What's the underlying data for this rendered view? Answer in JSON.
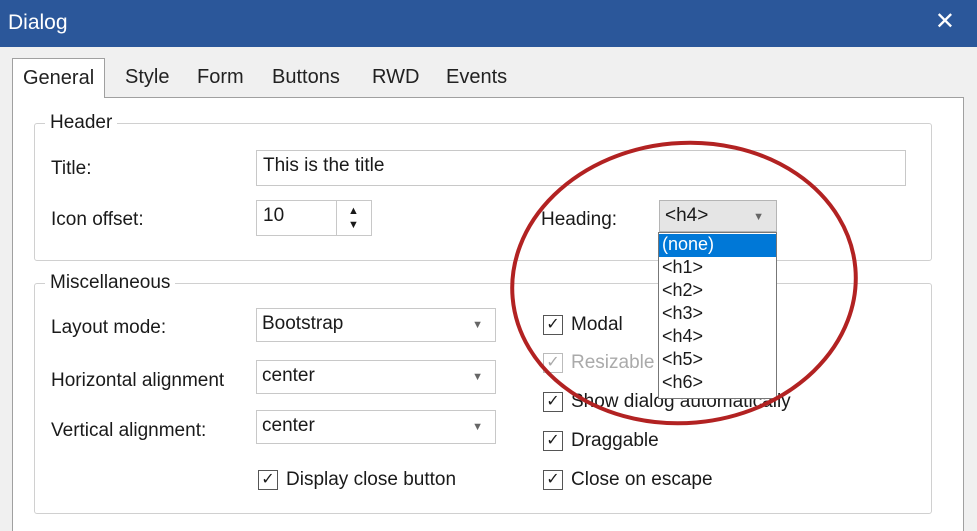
{
  "window": {
    "title": "Dialog",
    "close_glyph": "✕"
  },
  "tabs": [
    {
      "label": "General",
      "active": true
    },
    {
      "label": "Style"
    },
    {
      "label": "Form"
    },
    {
      "label": "Buttons"
    },
    {
      "label": "RWD"
    },
    {
      "label": "Events"
    }
  ],
  "header_group": {
    "legend": "Header",
    "title_label": "Title:",
    "title_value": "This is the title",
    "icon_offset_label": "Icon offset:",
    "icon_offset_value": "10",
    "heading_label": "Heading:",
    "heading_value": "<h4>"
  },
  "heading_dropdown": {
    "options": [
      "(none)",
      "<h1>",
      "<h2>",
      "<h3>",
      "<h4>",
      "<h5>",
      "<h6>"
    ],
    "highlighted": "(none)"
  },
  "misc_group": {
    "legend": "Miscellaneous",
    "layout_mode_label": "Layout mode:",
    "layout_mode_value": "Bootstrap",
    "halign_label": "Horizontal alignment",
    "halign_value": "center",
    "valign_label": "Vertical alignment:",
    "valign_value": "center",
    "display_close_label": "Display close button",
    "modal_label": "Modal",
    "resizable_label": "Resizable",
    "show_auto_label": "Show dialog automatically",
    "draggable_label": "Draggable",
    "close_escape_label": "Close on escape"
  },
  "checkmark_glyph": "✓",
  "colors": {
    "titlebar": "#2b579a",
    "selection": "#0078d7",
    "annotation": "#b22222"
  }
}
